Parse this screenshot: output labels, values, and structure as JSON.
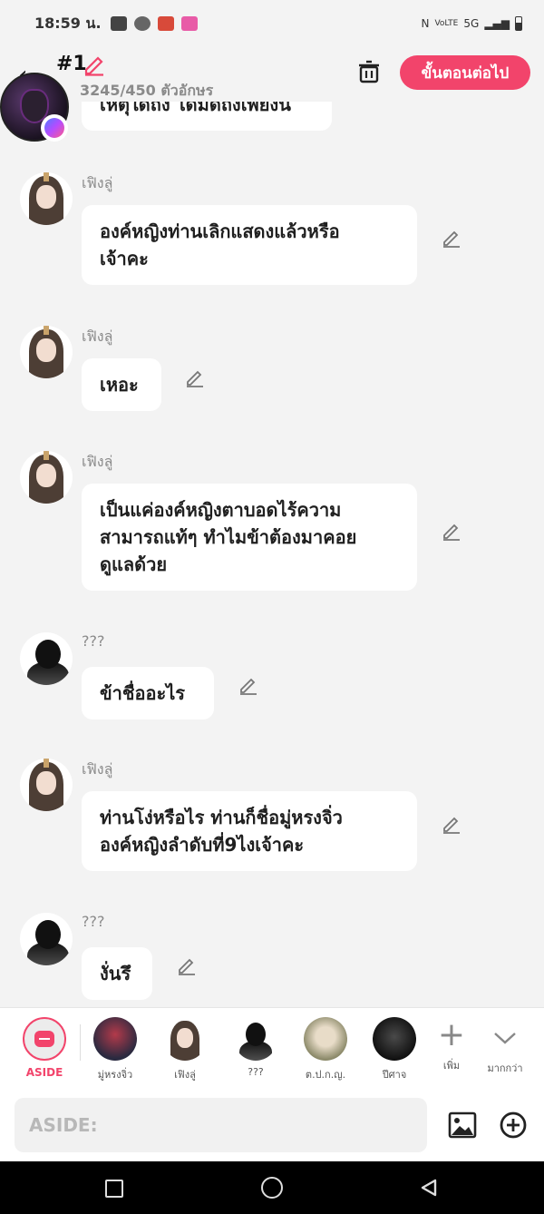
{
  "status_bar": {
    "time": "18:59 น.",
    "network": "5G"
  },
  "header": {
    "title": "#1",
    "char_count": "3245/450 ตัวอักษร",
    "next_label": "ขั้นตอนต่อไป"
  },
  "messages": [
    {
      "name": "",
      "text": "เหตุใดถึง ได้มิดถึงเพียงนี"
    },
    {
      "name": "เฟิงลู่",
      "text": "องค์หญิงท่านเลิกแสดงแล้วหรือ\nเจ้าคะ"
    },
    {
      "name": "เฟิงลู่",
      "text": "เหอะ"
    },
    {
      "name": "เฟิงลู่",
      "text": "เป็นแค่องค์หญิงตาบอดไร้ความ\nสามารถแท้ๆ ทำไมข้าต้องมาคอย\nดูแลด้วย"
    },
    {
      "name": "???",
      "text": "ข้าชื่ออะไร"
    },
    {
      "name": "เฟิงลู่",
      "text": "ท่านโง่หรือไร ท่านก็ชื่อมู่หรงจิ่ว\nองค์หญิงลำดับที่9ไงเจ้าคะ"
    },
    {
      "name": "???",
      "text": "งั่นรึ"
    }
  ],
  "tray": {
    "aside_label": "ASIDE",
    "characters": [
      {
        "label": "มู่หรงจิ่ว"
      },
      {
        "label": "เฟิงลู่"
      },
      {
        "label": "???"
      },
      {
        "label": "ต.ป.ก.ญ."
      },
      {
        "label": "ปีศาจ"
      }
    ],
    "add_label": "เพิ่ม",
    "more_label": "มากกว่า"
  },
  "input": {
    "placeholder": "ASIDE:"
  },
  "colors": {
    "accent": "#f2446b",
    "background": "#f3f3f3"
  }
}
